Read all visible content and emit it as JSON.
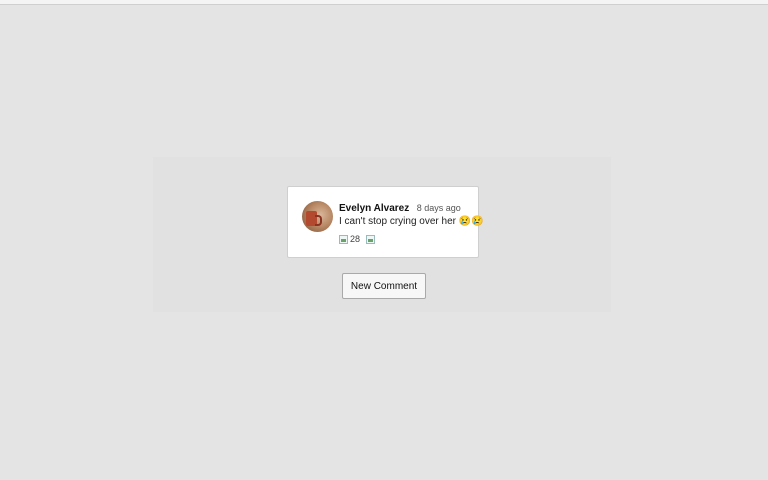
{
  "comment": {
    "author": "Evelyn Alvarez",
    "time": "8 days ago",
    "text": "I can't stop crying over her 😢😢",
    "like_count": "28",
    "avatar_icon": "avatar-photo",
    "like_icon": "like-icon",
    "reply_icon": "reply-icon"
  },
  "actions": {
    "new_comment_label": "New Comment"
  },
  "colors": {
    "background": "#e4e4e4",
    "card": "#ffffff",
    "button": "#f7f7f7"
  }
}
